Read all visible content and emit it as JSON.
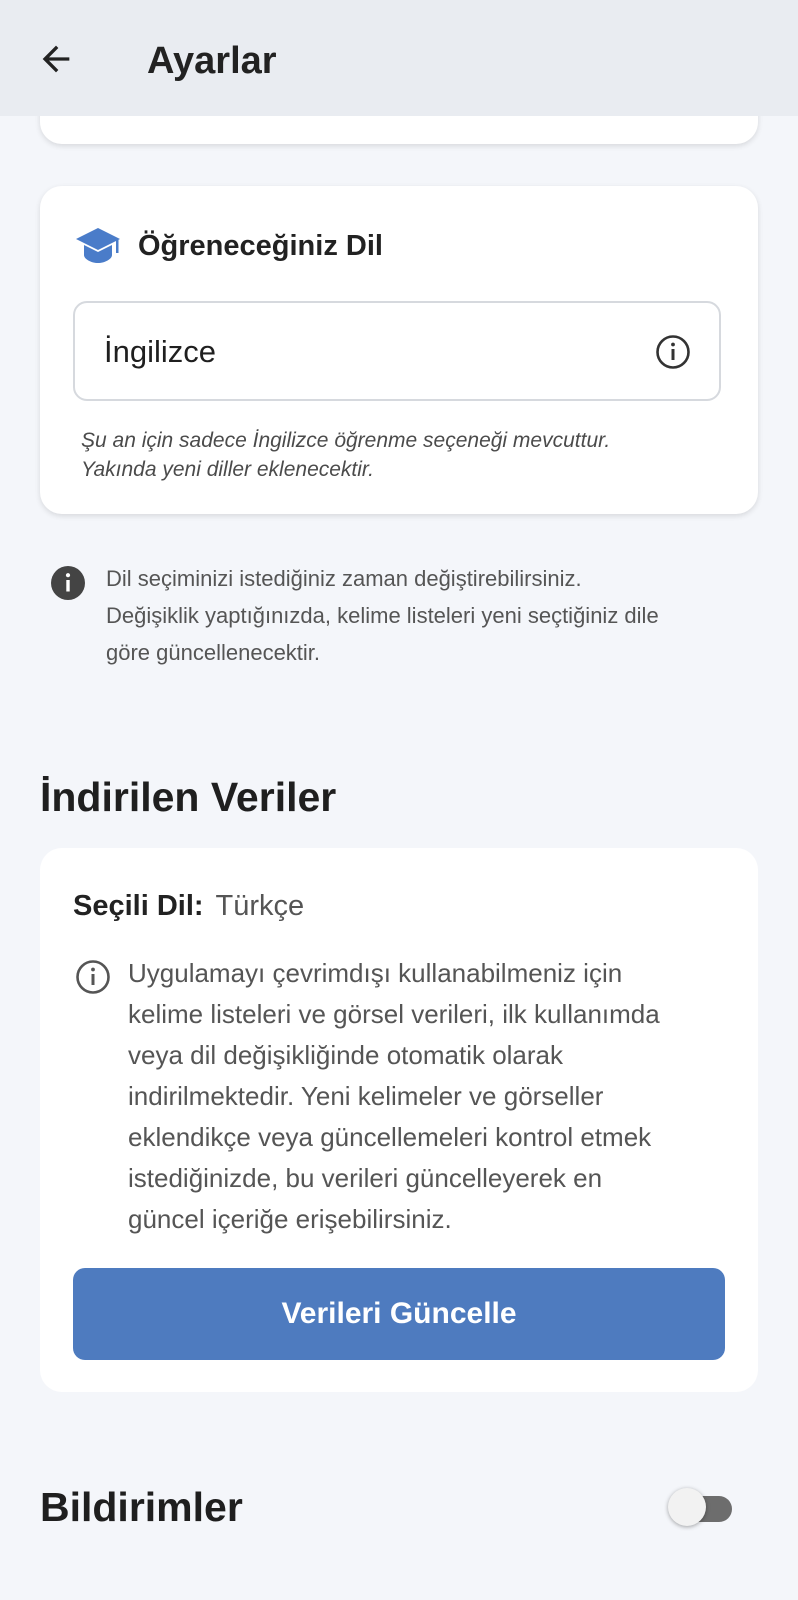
{
  "app_bar": {
    "title": "Ayarlar",
    "back_icon": "arrow-left-icon"
  },
  "language_card": {
    "icon": "graduation-cap-icon",
    "title": "Öğreneceğiniz Dil",
    "field_value": "İngilizce",
    "field_icon": "info-outline-icon",
    "note_line1": "Şu an için sadece İngilizce öğrenme seçeneği mevcuttur.",
    "note_line2": "Yakında yeni diller eklenecektir."
  },
  "language_hint": {
    "icon": "info-filled-icon",
    "line1": "Dil seçiminizi istediğiniz zaman değiştirebilirsiniz.",
    "line2": "Değişiklik yaptığınızda, kelime listeleri yeni seçtiğiniz dile",
    "line3": "göre güncellenecektir."
  },
  "downloaded_data": {
    "section_title": "İndirilen Veriler",
    "selected_label": "Seçili Dil:",
    "selected_value": "Türkçe",
    "info_icon": "info-outline-icon",
    "info_lines": [
      "Uygulamayı çevrimdışı kullanabilmeniz için",
      "kelime listeleri ve görsel verileri, ilk kullanımda",
      "veya dil değişikliğinde otomatik olarak",
      "indirilmektedir. Yeni kelimeler ve görseller",
      "eklendikçe veya güncellemeleri kontrol etmek",
      "istediğinizde, bu verileri güncelleyerek en",
      "güncel içeriğe erişebilirsiniz."
    ],
    "button_label": "Verileri Güncelle"
  },
  "notifications": {
    "section_title": "Bildirimler",
    "toggle_on": false
  },
  "colors": {
    "background": "#f4f6fa",
    "app_bar": "#e9ecf1",
    "accent": "#4e7bbf",
    "cap_icon": "#4a7cc9"
  }
}
